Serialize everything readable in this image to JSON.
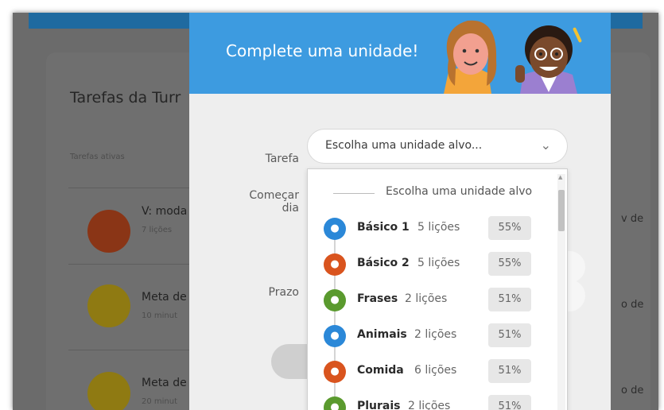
{
  "background": {
    "title": "Tarefas da Turr",
    "subtitle": "Tarefas ativas",
    "rows": [
      {
        "title": "V: moda",
        "sub": "7 lições",
        "right": "v de",
        "color": "#8a3516"
      },
      {
        "title": "Meta de",
        "sub": "10 minut",
        "right": "o de",
        "color": "#8f7a12"
      },
      {
        "title": "Meta de",
        "sub": "20 minut",
        "right": "o de",
        "color": "#8f7a12"
      }
    ]
  },
  "modal": {
    "title": "Complete uma unidade!",
    "form": {
      "task_label": "Tarefa",
      "start_label_line1": "Começar",
      "start_label_line2": "dia",
      "due_label": "Prazo",
      "select_value": "Escolha uma unidade alvo...",
      "select_chevron": "chevron-down-icon"
    },
    "dropdown": {
      "header": "Escolha uma unidade alvo",
      "options": [
        {
          "name": "Básico 1",
          "lessons": "5 lições",
          "pct": "55%",
          "color": "#2b88d8",
          "icon": "egg-icon"
        },
        {
          "name": "Básico 2",
          "lessons": "5 lições",
          "pct": "55%",
          "color": "#d9541e",
          "icon": "chick-icon"
        },
        {
          "name": "Frases",
          "lessons": "2 lições",
          "pct": "51%",
          "color": "#5a9a2e",
          "icon": "speech-bubble-icon"
        },
        {
          "name": "Animais",
          "lessons": "2 lições",
          "pct": "51%",
          "color": "#2b88d8",
          "icon": "bird-icon"
        },
        {
          "name": "Comida",
          "lessons": "6 lições",
          "pct": "51%",
          "color": "#d9541e",
          "icon": "burger-icon"
        },
        {
          "name": "Plurais",
          "lessons": "2 lições",
          "pct": "51%",
          "color": "#5a9a2e",
          "icon": "eye-icon"
        }
      ]
    }
  }
}
